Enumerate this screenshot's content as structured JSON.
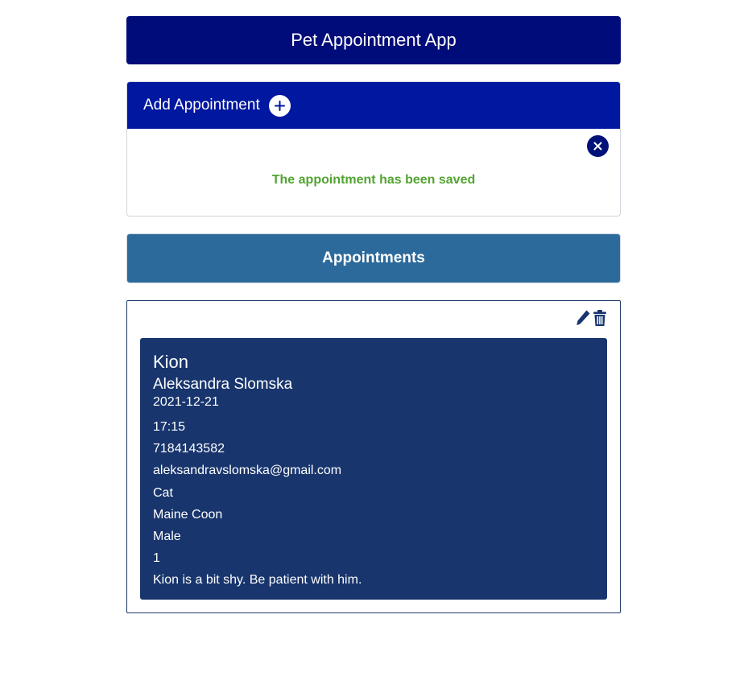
{
  "app": {
    "title": "Pet Appointment App"
  },
  "add_appointment": {
    "label": "Add Appointment",
    "toggle_icon": "plus-circle-icon",
    "close_icon": "x-circle-icon",
    "alert_message": "The appointment has been saved"
  },
  "appointments": {
    "heading": "Appointments",
    "items": [
      {
        "pet_name": "Kion",
        "owner_name": "Aleksandra Slomska",
        "date": "2021-12-21",
        "time": "17:15",
        "phone": "7184143582",
        "email": "aleksandravslomska@gmail.com",
        "animal": "Cat",
        "breed": "Maine Coon",
        "gender": "Male",
        "age": "1",
        "notes": "Kion is a bit shy. Be patient with him.",
        "edit_icon": "pencil-icon",
        "delete_icon": "trash-icon"
      }
    ]
  },
  "colors": {
    "header_bg": "#000c7a",
    "add_bar_bg": "#00179f",
    "success_text": "#52a431",
    "appointments_bar_bg": "#2c6a9c",
    "card_bg": "#18356d"
  }
}
